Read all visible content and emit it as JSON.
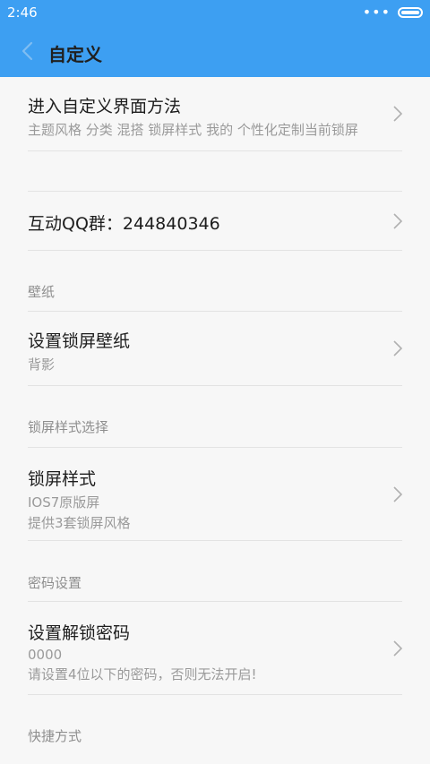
{
  "status_bar": {
    "time": "2:46",
    "more_dots": "•••"
  },
  "app_bar": {
    "title": "自定义"
  },
  "items": [
    {
      "title": "进入自定义界面方法",
      "lines": [
        "主题风格 分类 混搭 锁屏样式 我的 个性化定制当前锁屏"
      ]
    },
    {
      "title": "互动QQ群：244840346",
      "lines": []
    },
    {
      "title": "设置锁屏壁纸",
      "lines": [
        "背影"
      ]
    },
    {
      "title": "锁屏样式",
      "lines": [
        "IOS7原版屏",
        "提供3套锁屏风格"
      ]
    },
    {
      "title": "设置解锁密码",
      "lines": [
        "0000",
        "请设置4位以下的密码，否则无法开启!"
      ]
    }
  ],
  "sections": [
    "壁纸",
    "锁屏样式选择",
    "密码设置",
    "快捷方式"
  ],
  "colors": {
    "accent": "#3d9ff2",
    "background": "#f7f7f7",
    "divider": "#e3e3e3"
  }
}
